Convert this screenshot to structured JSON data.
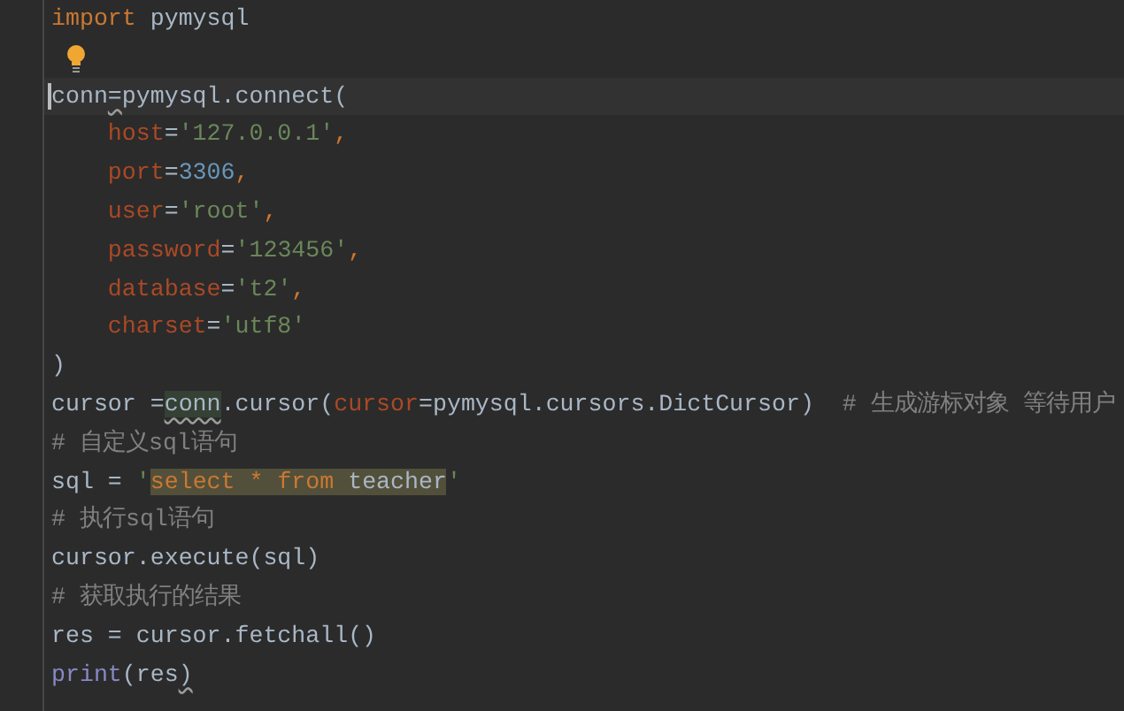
{
  "editor": {
    "lines": [
      {
        "current": false,
        "hint": false,
        "tokens": [
          {
            "text": "import",
            "kind": "keyword",
            "warning": false
          },
          {
            "text": " pymysql",
            "kind": "plain",
            "warning": false
          }
        ]
      },
      {
        "current": false,
        "hint": true
      },
      {
        "current": true,
        "hint": false,
        "tokens": [
          {
            "text": "conn",
            "kind": "plain",
            "warning": false
          },
          {
            "text": "=",
            "kind": "plain",
            "warning": true
          },
          {
            "text": "pymysql.connect(",
            "kind": "plain",
            "warning": false
          }
        ]
      },
      {
        "current": false,
        "hint": false,
        "tokens": [
          {
            "text": "    host",
            "kind": "param",
            "warning": false
          },
          {
            "text": "=",
            "kind": "plain",
            "warning": false
          },
          {
            "text": "'127.0.0.1'",
            "kind": "string",
            "warning": false
          },
          {
            "text": ",",
            "kind": "keyword",
            "warning": false
          }
        ]
      },
      {
        "current": false,
        "hint": false,
        "tokens": [
          {
            "text": "    port",
            "kind": "param",
            "warning": false
          },
          {
            "text": "=",
            "kind": "plain",
            "warning": false
          },
          {
            "text": "3306",
            "kind": "number",
            "warning": false
          },
          {
            "text": ",",
            "kind": "keyword",
            "warning": false
          }
        ]
      },
      {
        "current": false,
        "hint": false,
        "tokens": [
          {
            "text": "    user",
            "kind": "param",
            "warning": false
          },
          {
            "text": "=",
            "kind": "plain",
            "warning": false
          },
          {
            "text": "'root'",
            "kind": "string",
            "warning": false
          },
          {
            "text": ",",
            "kind": "keyword",
            "warning": false
          }
        ]
      },
      {
        "current": false,
        "hint": false,
        "tokens": [
          {
            "text": "    password",
            "kind": "param",
            "warning": false
          },
          {
            "text": "=",
            "kind": "plain",
            "warning": false
          },
          {
            "text": "'123456'",
            "kind": "string",
            "warning": false
          },
          {
            "text": ",",
            "kind": "keyword",
            "warning": false
          }
        ]
      },
      {
        "current": false,
        "hint": false,
        "tokens": [
          {
            "text": "    database",
            "kind": "param",
            "warning": false
          },
          {
            "text": "=",
            "kind": "plain",
            "warning": false
          },
          {
            "text": "'t2'",
            "kind": "string",
            "warning": false
          },
          {
            "text": ",",
            "kind": "keyword",
            "warning": false
          }
        ]
      },
      {
        "current": false,
        "hint": false,
        "tokens": [
          {
            "text": "    charset",
            "kind": "param",
            "warning": false
          },
          {
            "text": "=",
            "kind": "plain",
            "warning": false
          },
          {
            "text": "'utf8'",
            "kind": "string",
            "warning": false
          }
        ]
      },
      {
        "current": false,
        "hint": false,
        "tokens": [
          {
            "text": ")",
            "kind": "plain",
            "warning": false
          }
        ]
      },
      {
        "current": false,
        "hint": false,
        "tokens": [
          {
            "text": "cursor =",
            "kind": "plain",
            "warning": false
          },
          {
            "text": "conn",
            "kind": "reference",
            "warning": true
          },
          {
            "text": ".cursor(",
            "kind": "plain",
            "warning": false
          },
          {
            "text": "cursor",
            "kind": "param",
            "warning": false
          },
          {
            "text": "=pymysql.cursors.DictCursor)",
            "kind": "plain",
            "warning": false
          },
          {
            "text": "  # 生成游标对象 等待用户",
            "kind": "comment",
            "warning": false
          }
        ]
      },
      {
        "current": false,
        "hint": false,
        "tokens": [
          {
            "text": "# 自定义sql语句",
            "kind": "comment",
            "warning": false
          }
        ]
      },
      {
        "current": false,
        "hint": false,
        "tokens": [
          {
            "text": "sql = ",
            "kind": "plain",
            "warning": false
          },
          {
            "text": "'",
            "kind": "string",
            "warning": false
          },
          {
            "text": "select * from",
            "kind": "sql_keyword",
            "warning": false
          },
          {
            "text": " teacher",
            "kind": "sql_name",
            "warning": false
          },
          {
            "text": "'",
            "kind": "string",
            "warning": false
          }
        ]
      },
      {
        "current": false,
        "hint": false,
        "tokens": [
          {
            "text": "# 执行sql语句",
            "kind": "comment",
            "warning": false
          }
        ]
      },
      {
        "current": false,
        "hint": false,
        "tokens": [
          {
            "text": "cursor.execute(sql)",
            "kind": "plain",
            "warning": false
          }
        ]
      },
      {
        "current": false,
        "hint": false,
        "tokens": [
          {
            "text": "# 获取执行的结果",
            "kind": "comment",
            "warning": false
          }
        ]
      },
      {
        "current": false,
        "hint": false,
        "tokens": [
          {
            "text": "res = cursor.fetchall()",
            "kind": "plain",
            "warning": false
          }
        ]
      },
      {
        "current": false,
        "hint": false,
        "tokens": [
          {
            "text": "print",
            "kind": "builtin",
            "warning": false
          },
          {
            "text": "(res",
            "kind": "plain",
            "warning": false
          },
          {
            "text": ")",
            "kind": "plain",
            "warning": true
          }
        ]
      }
    ]
  }
}
